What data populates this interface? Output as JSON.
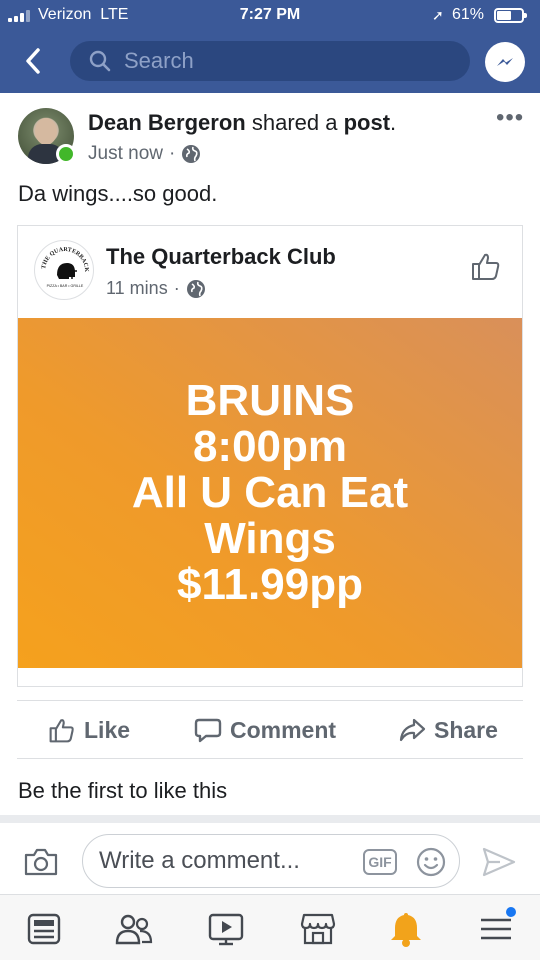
{
  "status_bar": {
    "carrier": "Verizon",
    "network": "LTE",
    "time": "7:27 PM",
    "battery": "61%",
    "battery_level": 0.61,
    "icons": [
      "signal-bars-icon",
      "location-arrow-icon",
      "battery-icon"
    ]
  },
  "header": {
    "search_placeholder": "Search",
    "icons": [
      "back-chevron-icon",
      "search-icon",
      "messenger-icon"
    ]
  },
  "post": {
    "author": "Dean Bergeron",
    "action_text": "shared a",
    "action_object": "post",
    "action_suffix": ".",
    "time": "Just now",
    "separator": "·",
    "privacy_icon": "globe-icon",
    "online": true,
    "text": "Da wings....so good."
  },
  "shared": {
    "page_name": "The Quarterback Club",
    "time": "11 mins",
    "separator": "·",
    "privacy_icon": "globe-icon",
    "logo_text": "THE QUARTERBACK CLUB",
    "logo_subtext": "PIZZA • BAR • GRILLE",
    "promo_lines": [
      "BRUINS",
      "8:00pm",
      "All U Can Eat",
      "Wings",
      "$11.99pp"
    ],
    "promo_color": "#f2a028"
  },
  "actions": {
    "like": "Like",
    "comment": "Comment",
    "share": "Share"
  },
  "likes_text": "Be the first to like this",
  "composer": {
    "placeholder": "Write a comment...",
    "gif": "GIF"
  },
  "tabbar": {
    "items": [
      "news-feed-icon",
      "friends-icon",
      "watch-icon",
      "marketplace-icon",
      "notifications-bell-icon",
      "menu-icon"
    ],
    "notification_badge": true
  },
  "colors": {
    "brand_blue": "#3b5998",
    "online_green": "#42b72a",
    "bell_orange": "#f2a31b",
    "text_gray": "#606770"
  }
}
